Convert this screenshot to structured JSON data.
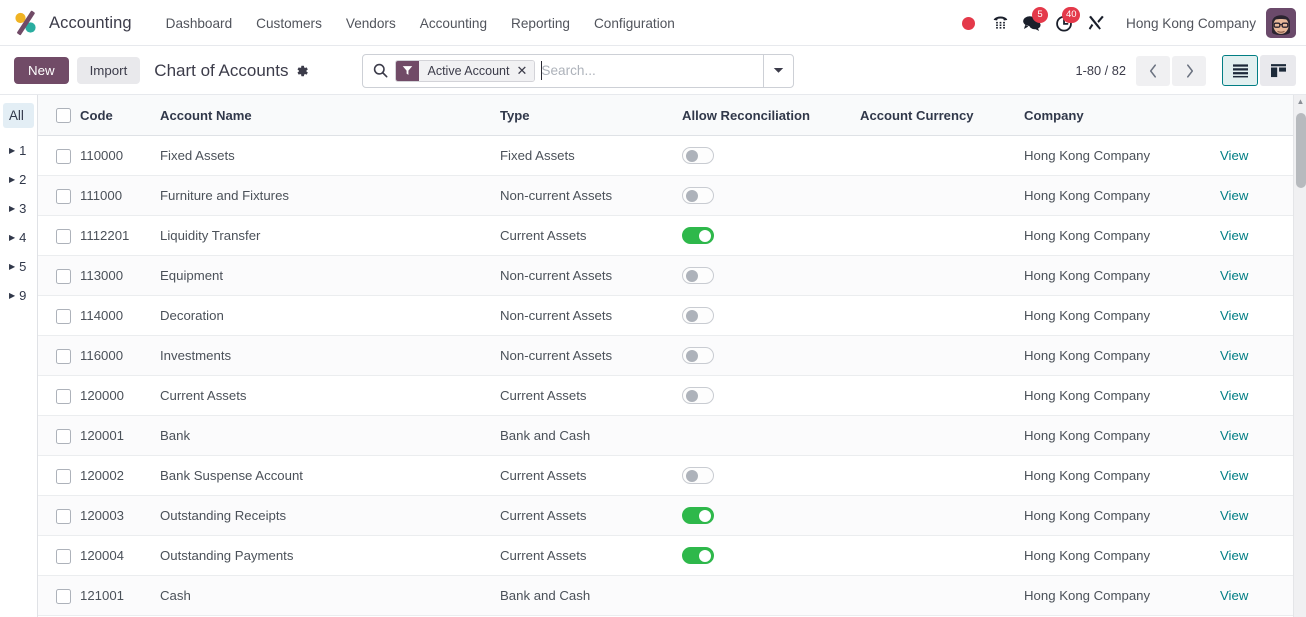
{
  "navbar": {
    "brand": "Accounting",
    "menu": [
      {
        "label": "Dashboard"
      },
      {
        "label": "Customers"
      },
      {
        "label": "Vendors"
      },
      {
        "label": "Accounting"
      },
      {
        "label": "Reporting"
      },
      {
        "label": "Configuration"
      }
    ],
    "icons": {
      "recording": "record-dot-icon",
      "phone": "phone-dialpad-icon",
      "messages": "chat-bubble-icon",
      "activities": "clock-activity-icon",
      "tools": "tools-wrench-icon"
    },
    "messages_badge": "5",
    "activities_badge": "40",
    "company": "Hong Kong Company",
    "avatar": "user-avatar"
  },
  "control_panel": {
    "new_label": "New",
    "import_label": "Import",
    "breadcrumb_title": "Chart of Accounts",
    "gear_icon": "gear-icon",
    "search": {
      "search_icon": "search-icon",
      "facet_icon": "filter-funnel-icon",
      "facet_label": "Active Account",
      "facet_remove": "✕",
      "placeholder": "Search...",
      "value": "",
      "dropdown_icon": "chevron-down-icon"
    },
    "pager": {
      "count": "1-80 / 82",
      "prev_icon": "chevron-left-icon",
      "next_icon": "chevron-right-icon"
    },
    "views": [
      {
        "name": "list-view",
        "active": true
      },
      {
        "name": "kanban-view",
        "active": false
      }
    ]
  },
  "side_panel": {
    "all_label": "All",
    "groups": [
      "1",
      "2",
      "3",
      "4",
      "5",
      "9"
    ]
  },
  "table": {
    "columns": [
      {
        "key": "code",
        "label": "Code"
      },
      {
        "key": "name",
        "label": "Account Name"
      },
      {
        "key": "type",
        "label": "Type"
      },
      {
        "key": "reconciliation",
        "label": "Allow Reconciliation"
      },
      {
        "key": "currency",
        "label": "Account Currency"
      },
      {
        "key": "company",
        "label": "Company"
      }
    ],
    "optional_columns_icon": "sliders-icon",
    "view_label": "View",
    "rows": [
      {
        "code": "110000",
        "name": "Fixed Assets",
        "type": "Fixed Assets",
        "reconcile": "off",
        "currency": "",
        "company": "Hong Kong Company",
        "action": "View"
      },
      {
        "code": "111000",
        "name": "Furniture and Fixtures",
        "type": "Non-current Assets",
        "reconcile": "off",
        "currency": "",
        "company": "Hong Kong Company",
        "action": "View"
      },
      {
        "code": "1112201",
        "name": "Liquidity Transfer",
        "type": "Current Assets",
        "reconcile": "on",
        "currency": "",
        "company": "Hong Kong Company",
        "action": "View"
      },
      {
        "code": "113000",
        "name": "Equipment",
        "type": "Non-current Assets",
        "reconcile": "off",
        "currency": "",
        "company": "Hong Kong Company",
        "action": "View"
      },
      {
        "code": "114000",
        "name": "Decoration",
        "type": "Non-current Assets",
        "reconcile": "off",
        "currency": "",
        "company": "Hong Kong Company",
        "action": "View"
      },
      {
        "code": "116000",
        "name": "Investments",
        "type": "Non-current Assets",
        "reconcile": "off",
        "currency": "",
        "company": "Hong Kong Company",
        "action": "View"
      },
      {
        "code": "120000",
        "name": "Current Assets",
        "type": "Current Assets",
        "reconcile": "off",
        "currency": "",
        "company": "Hong Kong Company",
        "action": "View"
      },
      {
        "code": "120001",
        "name": "Bank",
        "type": "Bank and Cash",
        "reconcile": "none",
        "currency": "",
        "company": "Hong Kong Company",
        "action": "View"
      },
      {
        "code": "120002",
        "name": "Bank Suspense Account",
        "type": "Current Assets",
        "reconcile": "off",
        "currency": "",
        "company": "Hong Kong Company",
        "action": "View"
      },
      {
        "code": "120003",
        "name": "Outstanding Receipts",
        "type": "Current Assets",
        "reconcile": "on",
        "currency": "",
        "company": "Hong Kong Company",
        "action": "View"
      },
      {
        "code": "120004",
        "name": "Outstanding Payments",
        "type": "Current Assets",
        "reconcile": "on",
        "currency": "",
        "company": "Hong Kong Company",
        "action": "View"
      },
      {
        "code": "121001",
        "name": "Cash",
        "type": "Bank and Cash",
        "reconcile": "none",
        "currency": "",
        "company": "Hong Kong Company",
        "action": "View"
      }
    ]
  },
  "colors": {
    "brand_purple": "#714b67",
    "accent_teal": "#017e84",
    "toggle_green": "#2eb84b",
    "badge_red": "#e4394a"
  }
}
